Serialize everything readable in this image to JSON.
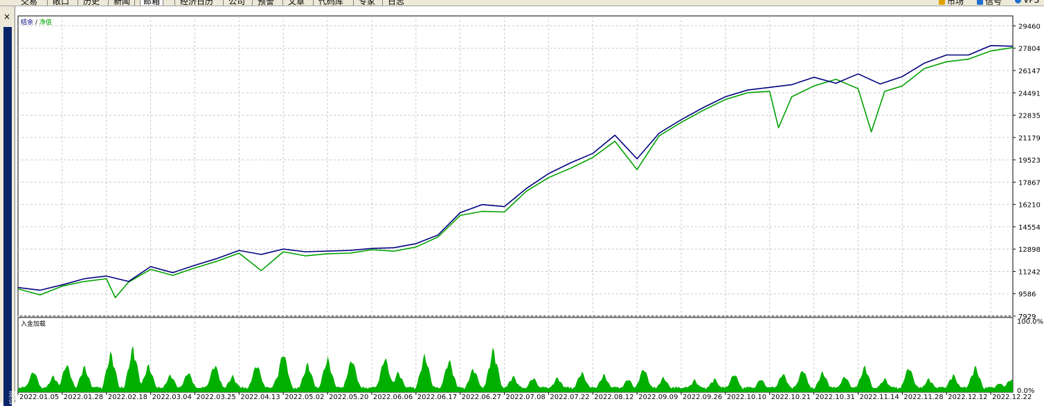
{
  "toolbar": {
    "tabs": [
      "交易",
      "敞口",
      "历史",
      "新闻",
      "邮箱",
      "经济日历",
      "公司",
      "预警",
      "文章",
      "代码库",
      "专家",
      "日志"
    ],
    "active_tab_index": 4,
    "right_items": [
      {
        "label": "市场",
        "icon": "bag-icon",
        "color": "#e0a000"
      },
      {
        "label": "信号",
        "icon": "signal-icon",
        "color": "#1f6fd0"
      },
      {
        "label": "VPS",
        "icon": "cloud-icon",
        "color": "#1f6fd0"
      }
    ]
  },
  "side_panel": {
    "label": "测试",
    "close_glyph": "×"
  },
  "chart_data": [
    {
      "type": "line",
      "legend": {
        "items": [
          "结余",
          "净值"
        ],
        "separator": " / ",
        "colors": [
          "#00007f",
          "#00a000"
        ],
        "position": "top-left"
      },
      "ylim": [
        7929,
        30200
      ],
      "yticks": [
        29460,
        27804,
        26147,
        24491,
        22835,
        21179,
        19523,
        17867,
        16210,
        14554,
        12898,
        11242,
        9586,
        7929
      ],
      "grid": true,
      "xticks": [
        "2022.01.05",
        "2022.01.28",
        "2022.02.18",
        "2022.03.04",
        "2022.03.25",
        "2022.04.13",
        "2022.05.02",
        "2022.05.20",
        "2022.06.06",
        "2022.06.17",
        "2022.06.27",
        "2022.07.08",
        "2022.07.22",
        "2022.08.12",
        "2022.09.09",
        "2022.09.26",
        "2022.10.10",
        "2022.10.21",
        "2022.10.31",
        "2022.11.14",
        "2022.11.28",
        "2022.12.12",
        "2022.12.22"
      ],
      "series": [
        {
          "name": "结余",
          "color": "#00007f",
          "x": [
            0,
            0.5,
            1,
            1.5,
            2,
            2.5,
            3,
            3.5,
            4,
            4.5,
            5,
            5.5,
            6,
            6.5,
            7,
            7.5,
            8,
            8.5,
            9,
            9.5,
            10,
            10.5,
            11,
            11.5,
            12,
            12.5,
            13,
            13.5,
            14,
            14.5,
            15,
            15.5,
            16,
            16.5,
            17,
            17.5,
            18,
            18.5,
            19,
            19.5,
            20,
            20.5,
            21,
            21.5,
            22,
            22.5
          ],
          "values": [
            10050,
            9850,
            10250,
            10700,
            10900,
            10500,
            11600,
            11150,
            11700,
            12200,
            12800,
            12500,
            12900,
            12700,
            12750,
            12800,
            12950,
            13000,
            13300,
            13950,
            15600,
            16200,
            16050,
            17400,
            18500,
            19300,
            20000,
            21350,
            19600,
            21500,
            22500,
            23400,
            24200,
            24700,
            24900,
            25100,
            25650,
            25200,
            25900,
            25150,
            25700,
            26700,
            27300,
            27300,
            28000,
            27950
          ]
        },
        {
          "name": "净值",
          "color": "#00a000",
          "x": [
            0,
            0.5,
            1,
            1.5,
            2,
            2.2,
            2.5,
            3,
            3.5,
            4,
            4.5,
            5,
            5.5,
            6,
            6.5,
            7,
            7.5,
            8,
            8.5,
            9,
            9.5,
            10,
            10.5,
            11,
            11.5,
            12,
            12.5,
            13,
            13.5,
            14,
            14.5,
            15,
            15.5,
            16,
            16.5,
            17,
            17.2,
            17.5,
            18,
            18.5,
            19,
            19.3,
            19.6,
            20,
            20.5,
            21,
            21.5,
            22,
            22.5
          ],
          "values": [
            9950,
            9500,
            10150,
            10500,
            10700,
            9300,
            10450,
            11400,
            10950,
            11500,
            12000,
            12600,
            11300,
            12700,
            12400,
            12550,
            12600,
            12850,
            12750,
            13050,
            13800,
            15400,
            15700,
            15650,
            17200,
            18200,
            18900,
            19700,
            20900,
            18800,
            21300,
            22300,
            23200,
            24000,
            24500,
            24600,
            21900,
            24200,
            25000,
            25500,
            24800,
            21600,
            24600,
            25000,
            26300,
            26800,
            27000,
            27600,
            27850
          ]
        }
      ]
    },
    {
      "type": "area",
      "title": "入金加载",
      "ylim": [
        0,
        100
      ],
      "yticks": [
        "100.0%",
        "0.0%"
      ],
      "color": "#00b000",
      "x_range": [
        0,
        22.5
      ],
      "peaks": [
        {
          "x": 0.35,
          "v": 32
        },
        {
          "x": 0.8,
          "v": 24
        },
        {
          "x": 1.1,
          "v": 42
        },
        {
          "x": 1.5,
          "v": 38
        },
        {
          "x": 2.1,
          "v": 58
        },
        {
          "x": 2.6,
          "v": 66
        },
        {
          "x": 2.95,
          "v": 40
        },
        {
          "x": 3.45,
          "v": 26
        },
        {
          "x": 3.85,
          "v": 30
        },
        {
          "x": 4.45,
          "v": 42
        },
        {
          "x": 4.85,
          "v": 24
        },
        {
          "x": 5.4,
          "v": 42
        },
        {
          "x": 5.9,
          "v": 26
        },
        {
          "x": 6.0,
          "v": 60
        },
        {
          "x": 6.55,
          "v": 42
        },
        {
          "x": 7.0,
          "v": 50
        },
        {
          "x": 7.55,
          "v": 50
        },
        {
          "x": 8.3,
          "v": 52
        },
        {
          "x": 8.6,
          "v": 30
        },
        {
          "x": 9.2,
          "v": 55
        },
        {
          "x": 9.75,
          "v": 48
        },
        {
          "x": 10.3,
          "v": 36
        },
        {
          "x": 10.75,
          "v": 64
        },
        {
          "x": 11.2,
          "v": 24
        },
        {
          "x": 11.65,
          "v": 22
        },
        {
          "x": 12.2,
          "v": 22
        },
        {
          "x": 12.75,
          "v": 30
        },
        {
          "x": 13.25,
          "v": 26
        },
        {
          "x": 13.8,
          "v": 20
        },
        {
          "x": 14.15,
          "v": 36
        },
        {
          "x": 14.6,
          "v": 22
        },
        {
          "x": 15.3,
          "v": 18
        },
        {
          "x": 15.75,
          "v": 20
        },
        {
          "x": 16.2,
          "v": 28
        },
        {
          "x": 16.8,
          "v": 20
        },
        {
          "x": 17.3,
          "v": 28
        },
        {
          "x": 17.75,
          "v": 34
        },
        {
          "x": 18.2,
          "v": 30
        },
        {
          "x": 18.7,
          "v": 24
        },
        {
          "x": 19.15,
          "v": 38
        },
        {
          "x": 19.6,
          "v": 20
        },
        {
          "x": 20.15,
          "v": 38
        },
        {
          "x": 20.6,
          "v": 20
        },
        {
          "x": 21.15,
          "v": 26
        },
        {
          "x": 21.65,
          "v": 38
        },
        {
          "x": 22.2,
          "v": 14
        },
        {
          "x": 22.45,
          "v": 20
        }
      ]
    }
  ]
}
